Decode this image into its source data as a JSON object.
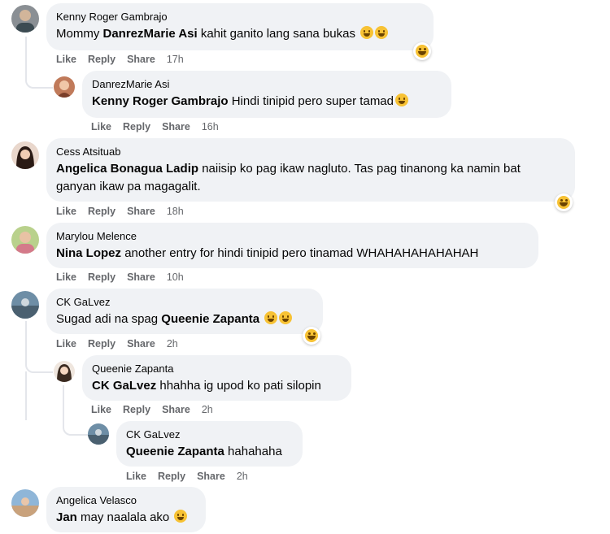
{
  "comments": [
    {
      "author": "Kenny Roger Gambrajo",
      "tag": "Mommy",
      "mention": "DanrezMarie Asi",
      "body": "kahit ganito lang sana bukas",
      "time": "17h"
    },
    {
      "author": "DanrezMarie Asi",
      "mention": "Kenny Roger Gambrajo",
      "body": "Hindi tinipid pero super tamad",
      "time": "16h"
    },
    {
      "author": "Cess Atsituab",
      "mention": "Angelica Bonagua Ladip",
      "body": "naiisip ko pag ikaw nagluto. Tas pag tinanong ka namin bat",
      "body2": "ganyan ikaw pa magagalit.",
      "time": "18h"
    },
    {
      "author": "Marylou Melence",
      "mention": "Nina Lopez",
      "body": "another entry for hindi tinipid pero tinamad WHAHAHAHAHAHAH",
      "time": "10h"
    },
    {
      "author": "CK GaLvez",
      "prefix": "Sugad adi na spag",
      "mention": "Queenie Zapanta",
      "time": "2h"
    },
    {
      "author": "Queenie Zapanta",
      "mention": "CK GaLvez",
      "body": "hhahha ig upod ko pati silopin",
      "time": "2h"
    },
    {
      "author": "CK GaLvez",
      "mention": "Queenie Zapanta",
      "body": "hahahaha",
      "time": "2h"
    },
    {
      "author": "Angelica Velasco",
      "mention": "Jan",
      "body": "may naalala ako",
      "time": ""
    }
  ],
  "actions": {
    "like": "Like",
    "reply": "Reply",
    "share": "Share"
  },
  "colors": {
    "bubble": "#f0f2f5",
    "meta": "#65676b",
    "emoji": "#f7c234"
  }
}
